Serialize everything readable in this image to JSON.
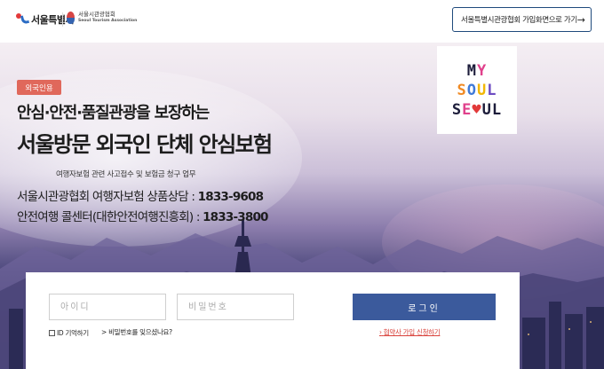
{
  "header": {
    "logo_seoul": "서울특별시",
    "logo_sta_ko": "서울시관광협회",
    "logo_sta_en": "Seoul Tourism Association",
    "join_button": "서울특별시관광협회 가입화면으로 가기",
    "join_arrow": "→"
  },
  "hero": {
    "badge": "외국인용",
    "subtitle": "안심·안전·품질관광을 보장하는",
    "title": "서울방문 외국인 단체 안심보험",
    "service_caption": "여행자보험 관련 사고접수 및 보험금 청구 업무",
    "contacts": [
      {
        "label": "서울시관광협회 여행자보험 상품상담 : ",
        "number": "1833-9608"
      },
      {
        "label": "안전여행 콜센터(대한안전여행진흥회) : ",
        "number": "1833-3800"
      }
    ]
  },
  "brand_logo": {
    "rows": [
      "MY",
      "SOUL",
      "SEOUL"
    ],
    "colors": {
      "dark": "#1c1c3a",
      "pink": "#e0418c",
      "orange": "#f08a24",
      "blue": "#3f7ad8",
      "yellow": "#f2b705",
      "purple": "#6d4cc2",
      "red": "#e23a3a"
    }
  },
  "login": {
    "id_placeholder": "아이디",
    "pw_placeholder": "비밀번호",
    "button": "로그인",
    "remember": "ID 기억하기",
    "forgot": "> 비밀번호를 잊으셨나요?",
    "apply": "협약사 가입 신청하기",
    "apply_bullet": "›"
  },
  "colors": {
    "accent_blue": "#3b5a9c",
    "badge_red": "#e0685b",
    "link_red": "#d9413a"
  }
}
